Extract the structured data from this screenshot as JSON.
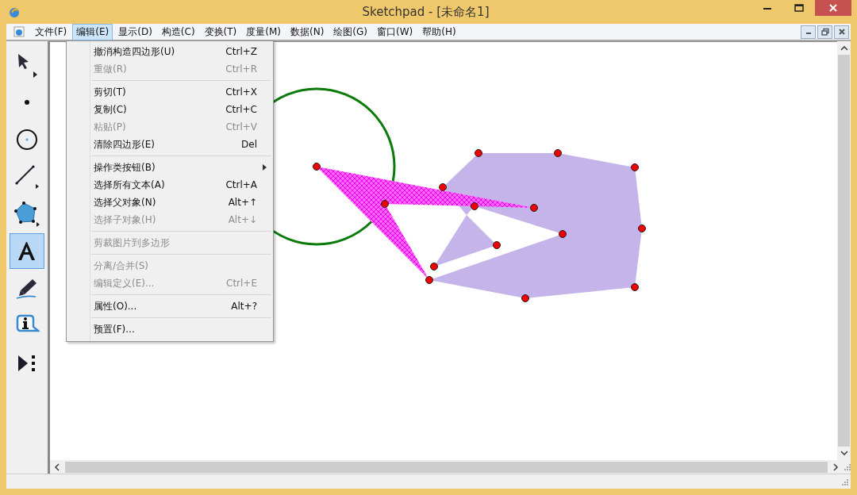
{
  "window": {
    "title": "Sketchpad  - [未命名1]"
  },
  "menu_bar": [
    {
      "label": "文件(F)",
      "selected": false
    },
    {
      "label": "编辑(E)",
      "selected": true
    },
    {
      "label": "显示(D)",
      "selected": false
    },
    {
      "label": "构造(C)",
      "selected": false
    },
    {
      "label": "变换(T)",
      "selected": false
    },
    {
      "label": "度量(M)",
      "selected": false
    },
    {
      "label": "数据(N)",
      "selected": false
    },
    {
      "label": "绘图(G)",
      "selected": false
    },
    {
      "label": "窗口(W)",
      "selected": false
    },
    {
      "label": "帮助(H)",
      "selected": false
    }
  ],
  "edit_menu": [
    {
      "kind": "item",
      "label": "撤消构造四边形(U)",
      "shortcut": "Ctrl+Z",
      "disabled": false,
      "submenu": false
    },
    {
      "kind": "item",
      "label": "重做(R)",
      "shortcut": "Ctrl+R",
      "disabled": true,
      "submenu": false
    },
    {
      "kind": "separator"
    },
    {
      "kind": "item",
      "label": "剪切(T)",
      "shortcut": "Ctrl+X",
      "disabled": false,
      "submenu": false
    },
    {
      "kind": "item",
      "label": "复制(C)",
      "shortcut": "Ctrl+C",
      "disabled": false,
      "submenu": false
    },
    {
      "kind": "item",
      "label": "粘贴(P)",
      "shortcut": "Ctrl+V",
      "disabled": true,
      "submenu": false
    },
    {
      "kind": "item",
      "label": "清除四边形(E)",
      "shortcut": "Del",
      "disabled": false,
      "submenu": false
    },
    {
      "kind": "separator"
    },
    {
      "kind": "item",
      "label": "操作类按钮(B)",
      "disabled": false,
      "submenu": true
    },
    {
      "kind": "item",
      "label": "选择所有文本(A)",
      "shortcut": "Ctrl+A",
      "disabled": false,
      "submenu": false
    },
    {
      "kind": "item",
      "label": "选择父对象(N)",
      "shortcut": "Alt+↑",
      "disabled": false,
      "submenu": false
    },
    {
      "kind": "item",
      "label": "选择子对象(H)",
      "shortcut": "Alt+↓",
      "disabled": true,
      "submenu": false
    },
    {
      "kind": "separator"
    },
    {
      "kind": "item",
      "label": "剪裁图片到多边形",
      "disabled": true,
      "submenu": false
    },
    {
      "kind": "separator"
    },
    {
      "kind": "item",
      "label": "分离/合并(S)",
      "disabled": true,
      "submenu": false
    },
    {
      "kind": "item",
      "label": "编辑定义(E)...",
      "shortcut": "Ctrl+E",
      "disabled": true,
      "submenu": false
    },
    {
      "kind": "separator"
    },
    {
      "kind": "item",
      "label": "属性(O)...",
      "shortcut": "Alt+?",
      "disabled": false,
      "submenu": false
    },
    {
      "kind": "separator"
    },
    {
      "kind": "item",
      "label": "预置(F)...",
      "disabled": false,
      "submenu": false
    }
  ],
  "toolbox": [
    {
      "kind": "arrow",
      "selected": false
    },
    {
      "kind": "point",
      "selected": false
    },
    {
      "kind": "compass",
      "selected": false
    },
    {
      "kind": "line",
      "selected": false
    },
    {
      "kind": "polygon",
      "selected": false
    },
    {
      "kind": "text",
      "selected": true
    },
    {
      "kind": "marker",
      "selected": false
    },
    {
      "kind": "info",
      "selected": false
    },
    {
      "kind": "custom",
      "selected": false
    }
  ]
}
